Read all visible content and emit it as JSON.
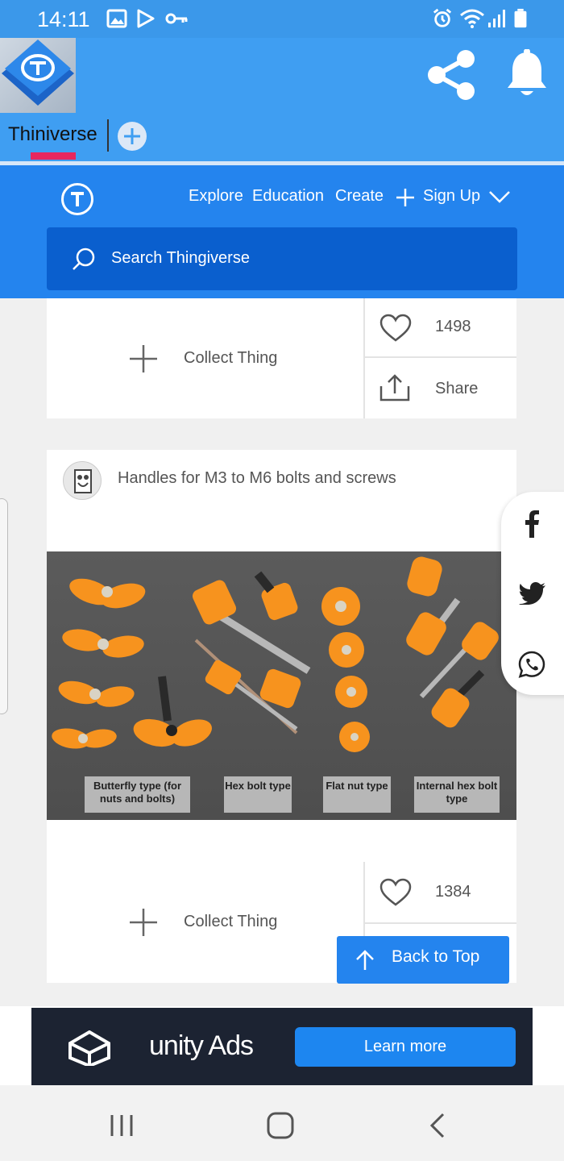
{
  "status_bar": {
    "time": "14:11"
  },
  "app_header": {
    "tab_label": "Thiniverse"
  },
  "site_nav": {
    "links": [
      "Explore",
      "Education",
      "Create",
      "Sign Up"
    ],
    "search_placeholder": "Search Thingiverse"
  },
  "card1": {
    "collect_label": "Collect Thing",
    "likes": "1498",
    "share_label": "Share"
  },
  "card2": {
    "title": "Handles for M3 to M6 bolts and screws",
    "image_captions": [
      "Butterfly type (for nuts and bolts)",
      "Hex bolt type",
      "Flat nut type",
      "Internal hex bolt type"
    ],
    "collect_label": "Collect Thing",
    "likes": "1384"
  },
  "back_to_top": "Back to Top",
  "ad": {
    "brand": "unity Ads",
    "cta": "Learn more"
  },
  "colors": {
    "status_bar": "#3b98ea",
    "app_header": "#3f9ef2",
    "site_nav": "#2484ee",
    "search_box": "#0a5fce",
    "tab_underline": "#e8265e",
    "thing_orange": "#f7931e"
  }
}
